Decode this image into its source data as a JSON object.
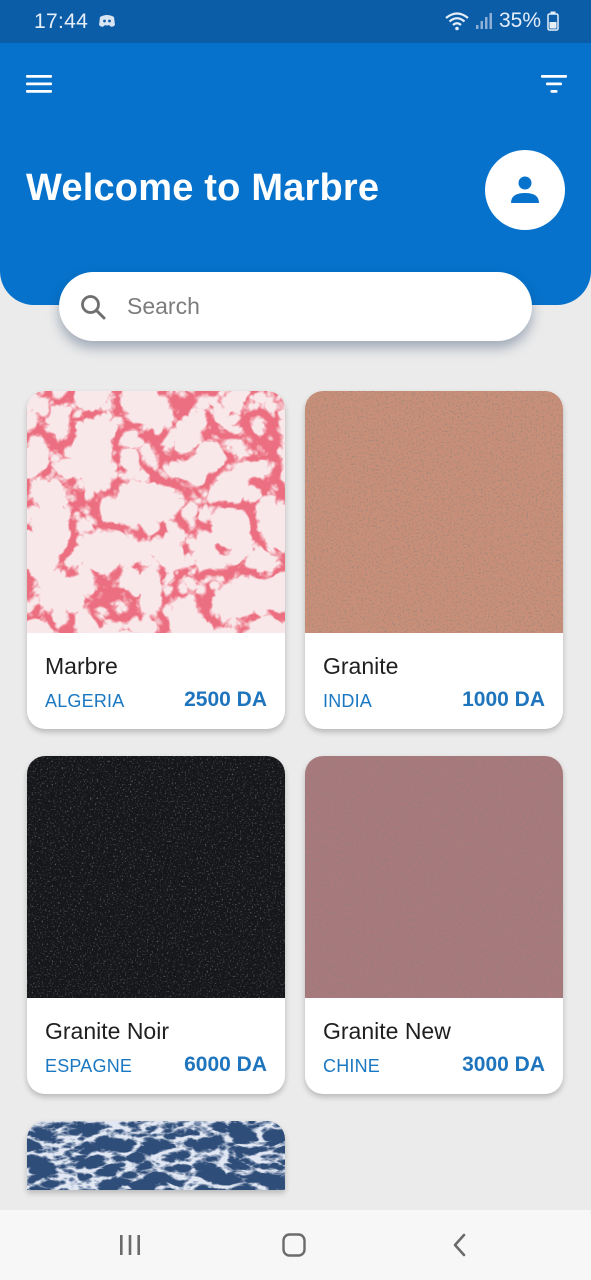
{
  "status": {
    "time": "17:44",
    "battery": "35%"
  },
  "header": {
    "title": "Welcome to Marbre",
    "icons": [
      "menu-icon",
      "filter-icon",
      "person-icon"
    ],
    "color": "#0672cb"
  },
  "search": {
    "placeholder": "Search",
    "value": ""
  },
  "products": [
    {
      "name": "Marbre",
      "origin": "ALGERIA",
      "price": "2500 DA"
    },
    {
      "name": "Granite",
      "origin": "INDIA",
      "price": "1000 DA"
    },
    {
      "name": "Granite Noir",
      "origin": "ESPAGNE",
      "price": "6000 DA"
    },
    {
      "name": "Granite New",
      "origin": "CHINE",
      "price": "3000 DA"
    }
  ],
  "nav": {
    "icons": [
      "recent-apps-icon",
      "home-icon",
      "back-icon"
    ]
  },
  "colors": {
    "accent": "#0672cb",
    "status_bar": "#0b5da8",
    "price_text": "#1f75bd",
    "background": "#ebebeb"
  }
}
